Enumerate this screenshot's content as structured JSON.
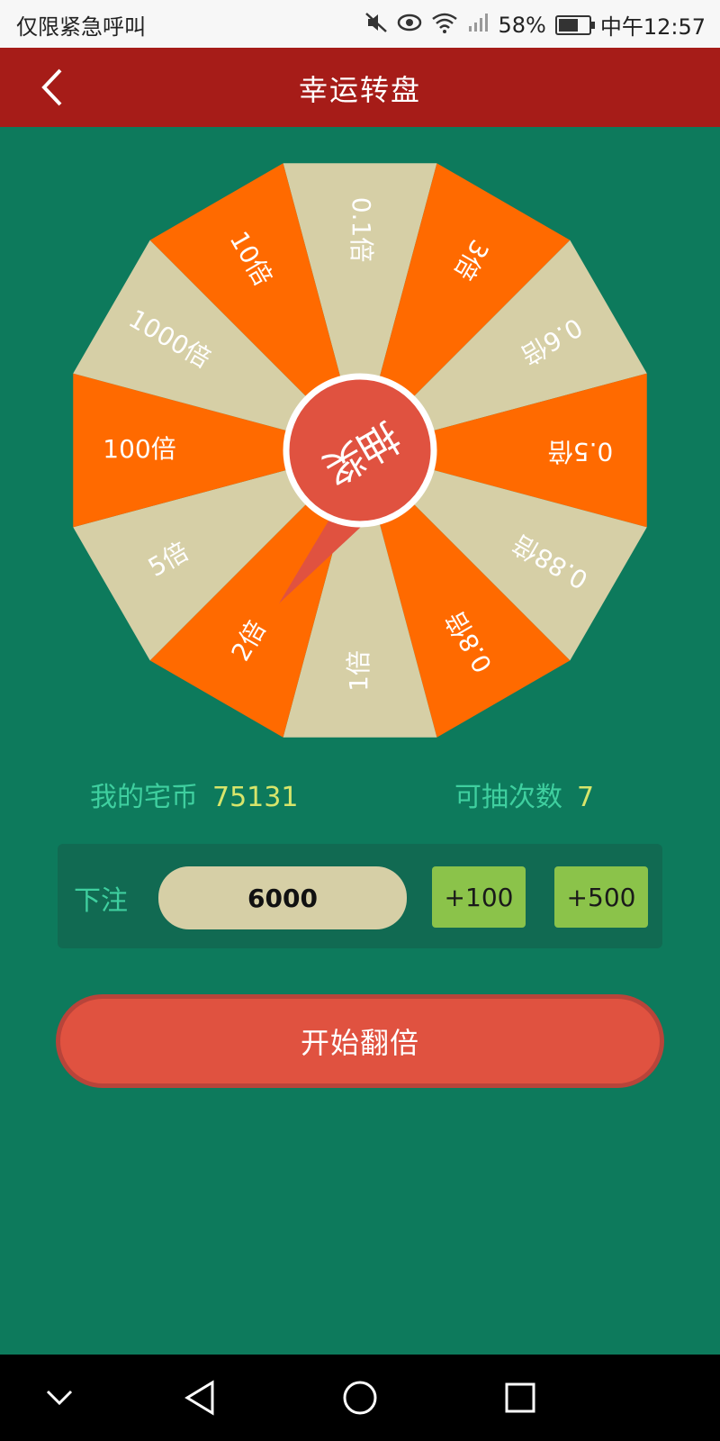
{
  "status_bar": {
    "left_text": "仅限紧急呼叫",
    "battery": "58%",
    "time": "中午12:57"
  },
  "app_bar": {
    "title": "幸运转盘"
  },
  "wheel": {
    "center_label": "抽奖",
    "segments": [
      {
        "label": "0.1倍",
        "color": "#d6cfa6"
      },
      {
        "label": "3倍",
        "color": "#ff6a00"
      },
      {
        "label": "0.6倍",
        "color": "#d6cfa6"
      },
      {
        "label": "0.5倍",
        "color": "#ff6a00"
      },
      {
        "label": "0.88倍",
        "color": "#d6cfa6"
      },
      {
        "label": "0.8倍",
        "color": "#ff6a00"
      },
      {
        "label": "1倍",
        "color": "#d6cfa6"
      },
      {
        "label": "2倍",
        "color": "#ff6a00"
      },
      {
        "label": "5倍",
        "color": "#d6cfa6"
      },
      {
        "label": "100倍",
        "color": "#ff6a00"
      },
      {
        "label": "1000倍",
        "color": "#d6cfa6"
      },
      {
        "label": "10倍",
        "color": "#ff6a00"
      }
    ],
    "center_color": "#e05240"
  },
  "stats": {
    "coins_label": "我的宅币",
    "coins_value": "75131",
    "draws_label": "可抽次数",
    "draws_value": "7"
  },
  "bet": {
    "label": "下注",
    "value": "6000",
    "add_100": "+100",
    "add_500": "+500"
  },
  "start_button": "开始翻倍"
}
